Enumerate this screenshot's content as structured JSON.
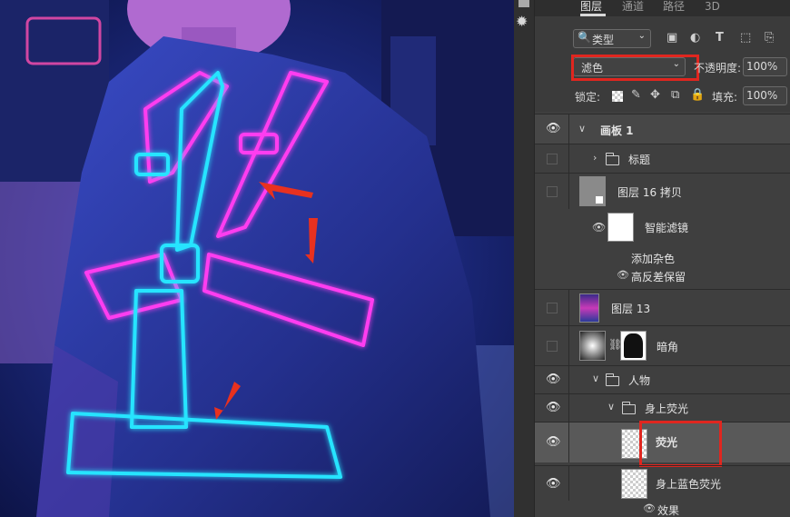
{
  "panel": {
    "tabs": [
      "图层",
      "通道",
      "路径",
      "3D"
    ],
    "filter": {
      "label": "类型",
      "icons": [
        "image-filter-icon",
        "adjustment-filter-icon",
        "type-filter-icon",
        "shape-filter-icon",
        "smart-object-filter-icon"
      ]
    },
    "blend_mode": "滤色",
    "opacity_label": "不透明度:",
    "opacity_value": "100%",
    "lock_label": "锁定:",
    "lock_icons": [
      "lock-transparent-icon",
      "lock-pixels-icon",
      "lock-position-icon",
      "lock-artboard-icon",
      "lock-all-icon"
    ],
    "fill_label": "填充:",
    "fill_value": "100%",
    "layers": [
      {
        "name": "画板 1",
        "visible": true,
        "kind": "artboard"
      },
      {
        "name": "标题",
        "visible": false,
        "kind": "folder"
      },
      {
        "name": "图层 16 拷贝",
        "visible": false,
        "kind": "smart-object"
      },
      {
        "name": "智能滤镜",
        "visible": true,
        "kind": "smart-filter"
      },
      {
        "name": "添加杂色",
        "kind": "filter"
      },
      {
        "name": "高反差保留",
        "visible": true,
        "kind": "filter"
      },
      {
        "name": "图层 13",
        "visible": false,
        "kind": "image"
      },
      {
        "name": "暗角",
        "visible": false,
        "kind": "adjustment"
      },
      {
        "name": "人物",
        "visible": true,
        "kind": "folder"
      },
      {
        "name": "身上荧光",
        "visible": true,
        "kind": "folder"
      },
      {
        "name": "荧光",
        "visible": true,
        "kind": "layer",
        "selected": true
      },
      {
        "name": "身上蓝色荧光",
        "visible": true,
        "kind": "layer"
      },
      {
        "name": "效果",
        "visible": true,
        "kind": "effects"
      }
    ]
  },
  "colors": {
    "highlight": "#e0261f",
    "neon_pink": "#ff3cf0",
    "neon_cyan": "#27e4ff",
    "panel_bg": "#3b3b3b"
  }
}
